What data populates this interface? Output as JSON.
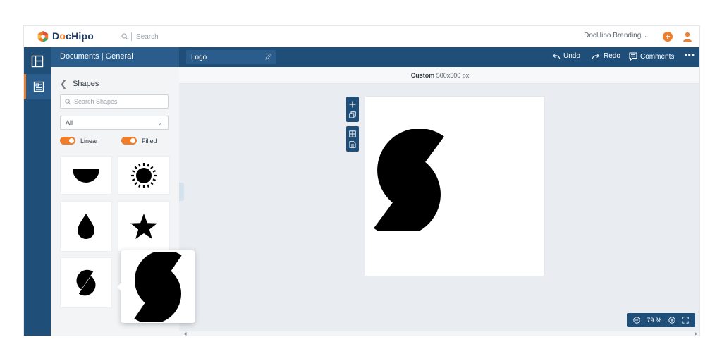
{
  "app": {
    "brand_prefix": "D",
    "brand_o": "o",
    "brand_suffix": "cHipo",
    "search_placeholder": "Search",
    "brand_kit_label": "DocHipo Branding",
    "plus_label": "+"
  },
  "sidebar": {
    "header": "Documents | General",
    "back_label": "Shapes",
    "search_placeholder": "Search Shapes",
    "filter_value": "All",
    "toggles": [
      {
        "label": "Linear",
        "on": true
      },
      {
        "label": "Filled",
        "on": true
      }
    ],
    "shapes": [
      {
        "icon": "half-circle-icon"
      },
      {
        "icon": "sun-icon"
      },
      {
        "icon": "drop-icon"
      },
      {
        "icon": "star-icon"
      },
      {
        "icon": "split-circle-icon"
      }
    ],
    "preview_icon": "split-circle-icon"
  },
  "toolbar": {
    "document_name": "Logo",
    "undo": "Undo",
    "redo": "Redo",
    "comments": "Comments",
    "more": "•••"
  },
  "canvas": {
    "size_label": "Custom",
    "size_value": "500x500 px",
    "shape_icon": "split-circle-icon"
  },
  "zoom": {
    "value": "79",
    "unit": "%"
  },
  "colors": {
    "accent": "#f07d2a",
    "navy": "#1f4e79",
    "navy_light": "#2a5d8c"
  }
}
